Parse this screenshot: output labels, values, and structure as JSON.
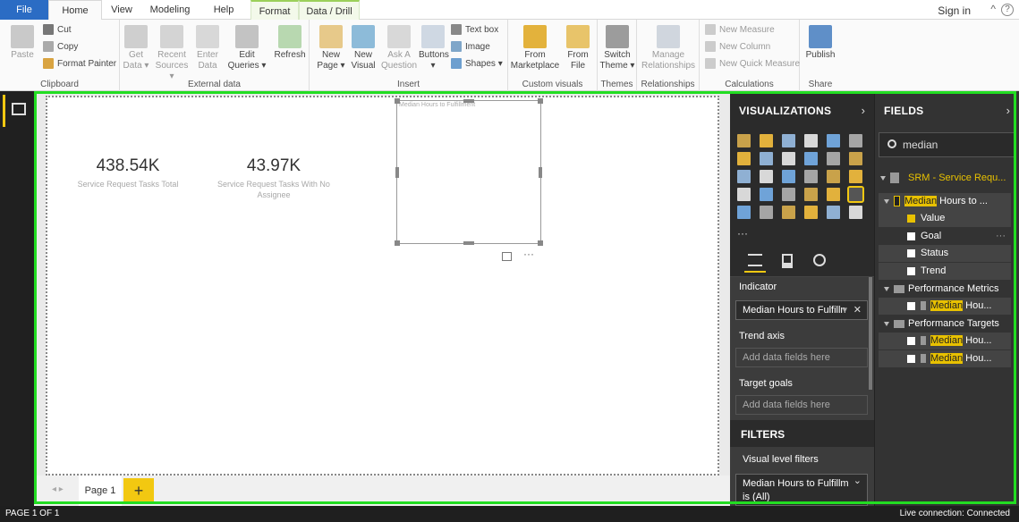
{
  "colors": {
    "accent": "#f2c811",
    "file_tab": "#2b6cc4",
    "selection_frame": "#22dd22",
    "highlight": "#e8c100"
  },
  "tabs": [
    {
      "label": "File"
    },
    {
      "label": "Home"
    },
    {
      "label": "View"
    },
    {
      "label": "Modeling"
    },
    {
      "label": "Help"
    },
    {
      "label": "Format"
    },
    {
      "label": "Data / Drill"
    }
  ],
  "header": {
    "sign_in": "Sign in",
    "collapse": "^",
    "help": "?"
  },
  "ribbon": {
    "clipboard": {
      "paste": "Paste",
      "cut": "Cut",
      "copy": "Copy",
      "format_painter": "Format Painter",
      "label": "Clipboard"
    },
    "external": {
      "get_data_1": "Get",
      "get_data_2": "Data ▾",
      "recent_1": "Recent",
      "recent_2": "Sources ▾",
      "enter_1": "Enter",
      "enter_2": "Data",
      "edit_1": "Edit",
      "edit_2": "Queries ▾",
      "refresh": "Refresh",
      "label": "External data"
    },
    "insert": {
      "new_page_1": "New",
      "new_page_2": "Page ▾",
      "new_visual_1": "New",
      "new_visual_2": "Visual",
      "ask_1": "Ask A",
      "ask_2": "Question",
      "buttons": "Buttons",
      "buttons_caret": "▾",
      "text_box": "Text box",
      "image": "Image",
      "shapes": "Shapes ▾",
      "label": "Insert"
    },
    "custom": {
      "market_1": "From",
      "market_2": "Marketplace",
      "file_1": "From",
      "file_2": "File",
      "label": "Custom visuals"
    },
    "themes": {
      "switch_1": "Switch",
      "switch_2": "Theme ▾",
      "label": "Themes"
    },
    "relationships": {
      "manage_1": "Manage",
      "manage_2": "Relationships",
      "label": "Relationships"
    },
    "calculations": {
      "new_measure": "New Measure",
      "new_column": "New Column",
      "new_quick_measure": "New Quick Measure",
      "label": "Calculations"
    },
    "share": {
      "publish": "Publish",
      "label": "Share"
    }
  },
  "canvas": {
    "cards": [
      {
        "value": "438.54K",
        "caption": "Service Request Tasks Total"
      },
      {
        "value": "43.97K",
        "caption": "Service Request Tasks With No Assignee"
      }
    ],
    "kpi_title": "Median Hours to Fulfillment",
    "more": "···",
    "page_tab": "Page 1",
    "add_page": "+",
    "page_nav": "◂  ▸"
  },
  "visualizations": {
    "title": "VISUALIZATIONS",
    "chevron": "›",
    "more": "···",
    "wells": [
      {
        "label": "Indicator",
        "value": "Median Hours to Fulfilln",
        "value_caret": "▾",
        "remove": "✕"
      },
      {
        "label": "Trend axis",
        "placeholder": "Add data fields here"
      },
      {
        "label": "Target goals",
        "placeholder": "Add data fields here"
      }
    ],
    "filters_title": "FILTERS",
    "visual_level_filters": "Visual level filters",
    "filter_item": "Median Hours to Fulfillm",
    "filter_caret": "⌄",
    "filter_value": "is (All)"
  },
  "fields": {
    "title": "FIELDS",
    "chevron": "›",
    "search_value": "median",
    "table": "SRM - Service Requ...",
    "kpi_field": {
      "hl": "Median",
      "rest": " Hours to ..."
    },
    "kpi_children": [
      {
        "label": "Value",
        "checked": true
      },
      {
        "label": "Goal",
        "checked": false
      },
      {
        "label": "Status",
        "checked": false
      },
      {
        "label": "Trend",
        "checked": false
      }
    ],
    "goal_more": "···",
    "folders": [
      {
        "name": "Performance Metrics",
        "items": [
          {
            "hl": "Median",
            "rest": " Hou..."
          }
        ]
      },
      {
        "name": "Performance Targets",
        "items": [
          {
            "hl": "Median",
            "rest": " Hou..."
          },
          {
            "hl": "Median",
            "rest": " Hou..."
          }
        ]
      }
    ]
  },
  "status": {
    "page": "PAGE 1 OF 1",
    "connection": "Live connection: Connected"
  }
}
